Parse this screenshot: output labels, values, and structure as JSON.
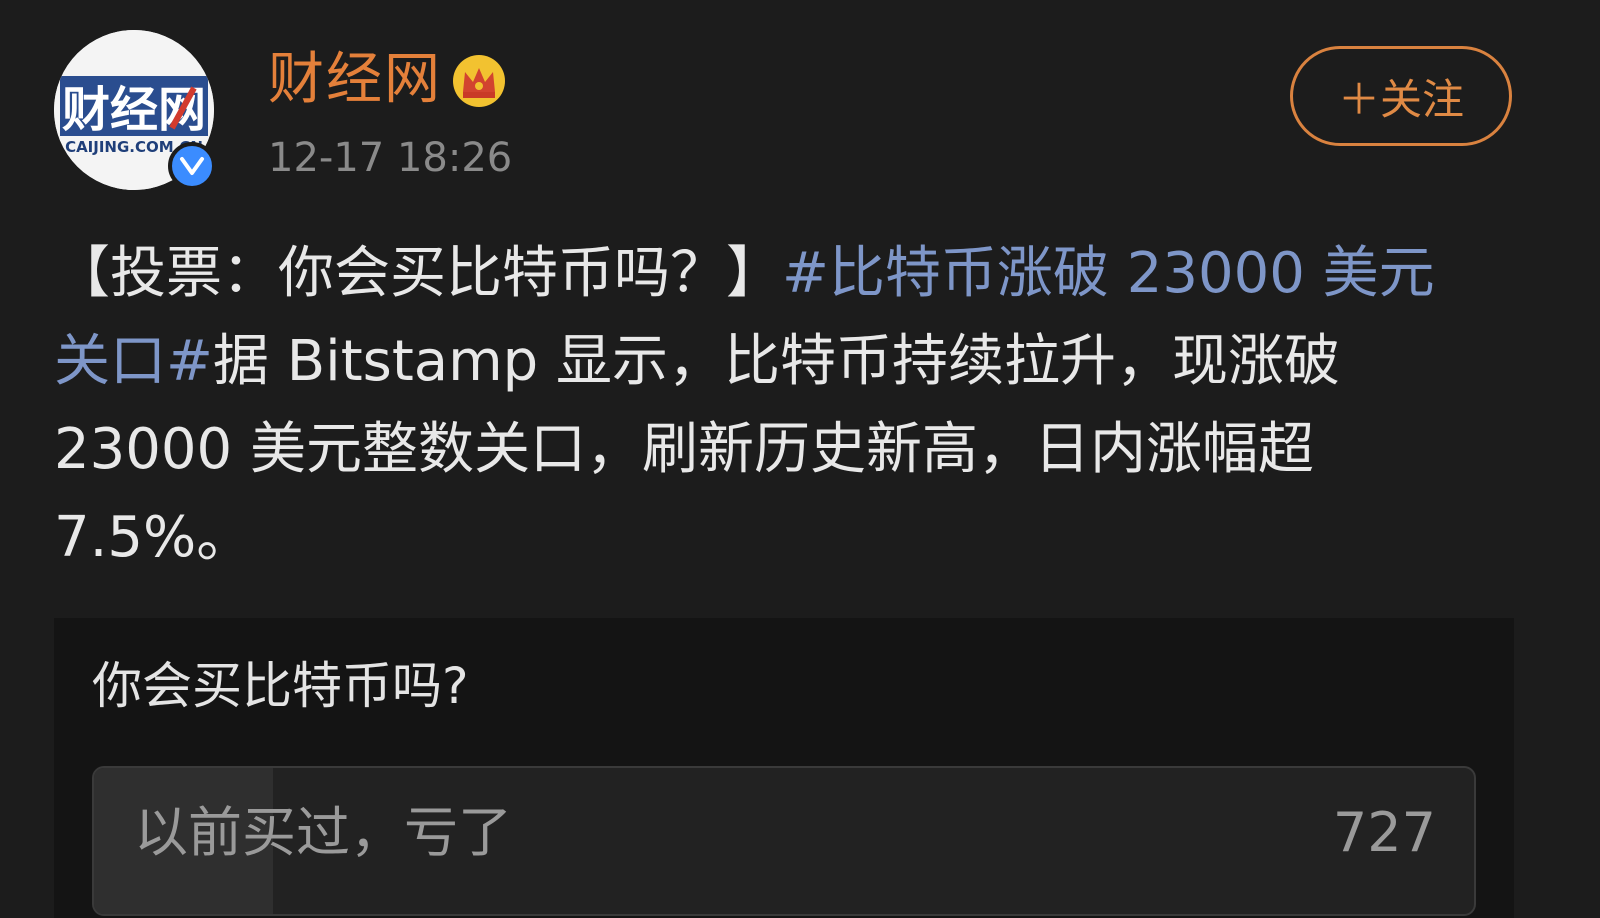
{
  "author": {
    "name": "财经网",
    "avatar_logo_text": "财经网",
    "avatar_logo_subtext": "CAIJING.COM.CN",
    "badge_icon": "crown-icon",
    "verified_icon": "verified-check-icon",
    "time": "12-17 18:26"
  },
  "follow_button": {
    "label": "＋关注"
  },
  "post": {
    "prefix": "【投票：你会买比特币吗？】",
    "topic": "#比特币涨破 23000 美元关口#",
    "body": "据 Bitstamp 显示，比特币持续拉升，现涨破23000 美元整数关口，刷新历史新高，日内涨幅超7.5%。"
  },
  "poll": {
    "question": "你会买比特币吗?",
    "options": [
      {
        "label": "以前买过，亏了",
        "count": "727",
        "fill_fraction": 0.13
      }
    ]
  },
  "colors": {
    "background": "#1c1c1c",
    "author_name": "#e4803a",
    "topic_link": "#7e96c8",
    "follow_border": "#d9823f",
    "verified_badge": "#3b8cff"
  }
}
